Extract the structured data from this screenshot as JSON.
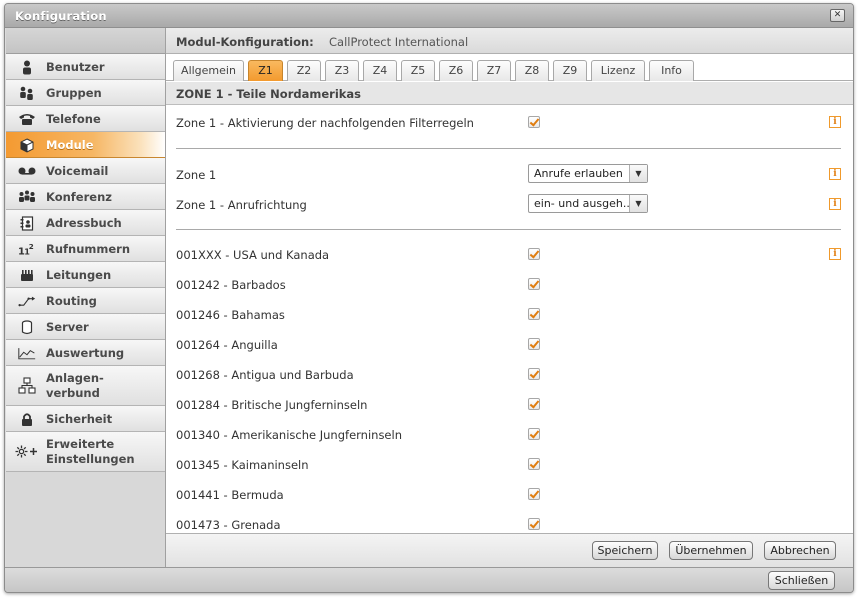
{
  "window": {
    "title": "Konfiguration"
  },
  "sidebar": {
    "items": [
      {
        "label": "Benutzer",
        "icon": "user-icon"
      },
      {
        "label": "Gruppen",
        "icon": "group-icon"
      },
      {
        "label": "Telefone",
        "icon": "phone-icon"
      },
      {
        "label": "Module",
        "icon": "module-icon"
      },
      {
        "label": "Voicemail",
        "icon": "voicemail-icon"
      },
      {
        "label": "Konferenz",
        "icon": "conference-icon"
      },
      {
        "label": "Adressbuch",
        "icon": "addressbook-icon"
      },
      {
        "label": "Rufnummern",
        "icon": "numbers-icon"
      },
      {
        "label": "Leitungen",
        "icon": "lines-icon"
      },
      {
        "label": "Routing",
        "icon": "routing-icon"
      },
      {
        "label": "Server",
        "icon": "server-icon"
      },
      {
        "label": "Auswertung",
        "icon": "chart-icon"
      },
      {
        "label_line1": "Anlagen-",
        "label_line2": "verbund",
        "icon": "network-icon"
      },
      {
        "label": "Sicherheit",
        "icon": "lock-icon"
      },
      {
        "label_line1": "Erweiterte",
        "label_line2": "Einstellungen",
        "icon": "advanced-settings-icon"
      }
    ],
    "active": "Module"
  },
  "header": {
    "title": "Modul-Konfiguration:",
    "subtitle": "CallProtect International"
  },
  "tabs": [
    "Allgemein",
    "Z1",
    "Z2",
    "Z3",
    "Z4",
    "Z5",
    "Z6",
    "Z7",
    "Z8",
    "Z9",
    "Lizenz",
    "Info"
  ],
  "active_tab": "Z1",
  "section": {
    "title": "ZONE 1 - Teile Nordamerikas"
  },
  "settings": {
    "activation": {
      "label": "Zone 1 - Aktivierung der nachfolgenden Filterregeln",
      "checked": true
    },
    "zone": {
      "label": "Zone 1",
      "value": "Anrufe erlauben"
    },
    "direction": {
      "label": "Zone 1 - Anrufrichtung",
      "value": "ein- und ausgeh..."
    }
  },
  "prefixes": [
    {
      "label": "001XXX - USA und Kanada",
      "checked": true
    },
    {
      "label": "001242 - Barbados",
      "checked": true
    },
    {
      "label": "001246 - Bahamas",
      "checked": true
    },
    {
      "label": "001264 - Anguilla",
      "checked": true
    },
    {
      "label": "001268 - Antigua und Barbuda",
      "checked": true
    },
    {
      "label": "001284 - Britische Jungferninseln",
      "checked": true
    },
    {
      "label": "001340 - Amerikanische Jungferninseln",
      "checked": true
    },
    {
      "label": "001345 - Kaimaninseln",
      "checked": true
    },
    {
      "label": "001441 - Bermuda",
      "checked": true
    },
    {
      "label": "001473 - Grenada",
      "checked": true
    }
  ],
  "footer": {
    "save": "Speichern",
    "apply": "Übernehmen",
    "cancel": "Abbrechen"
  },
  "bottom": {
    "close": "Schließen"
  },
  "colors": {
    "accent": "#f39a2e",
    "check": "#e07d10"
  }
}
